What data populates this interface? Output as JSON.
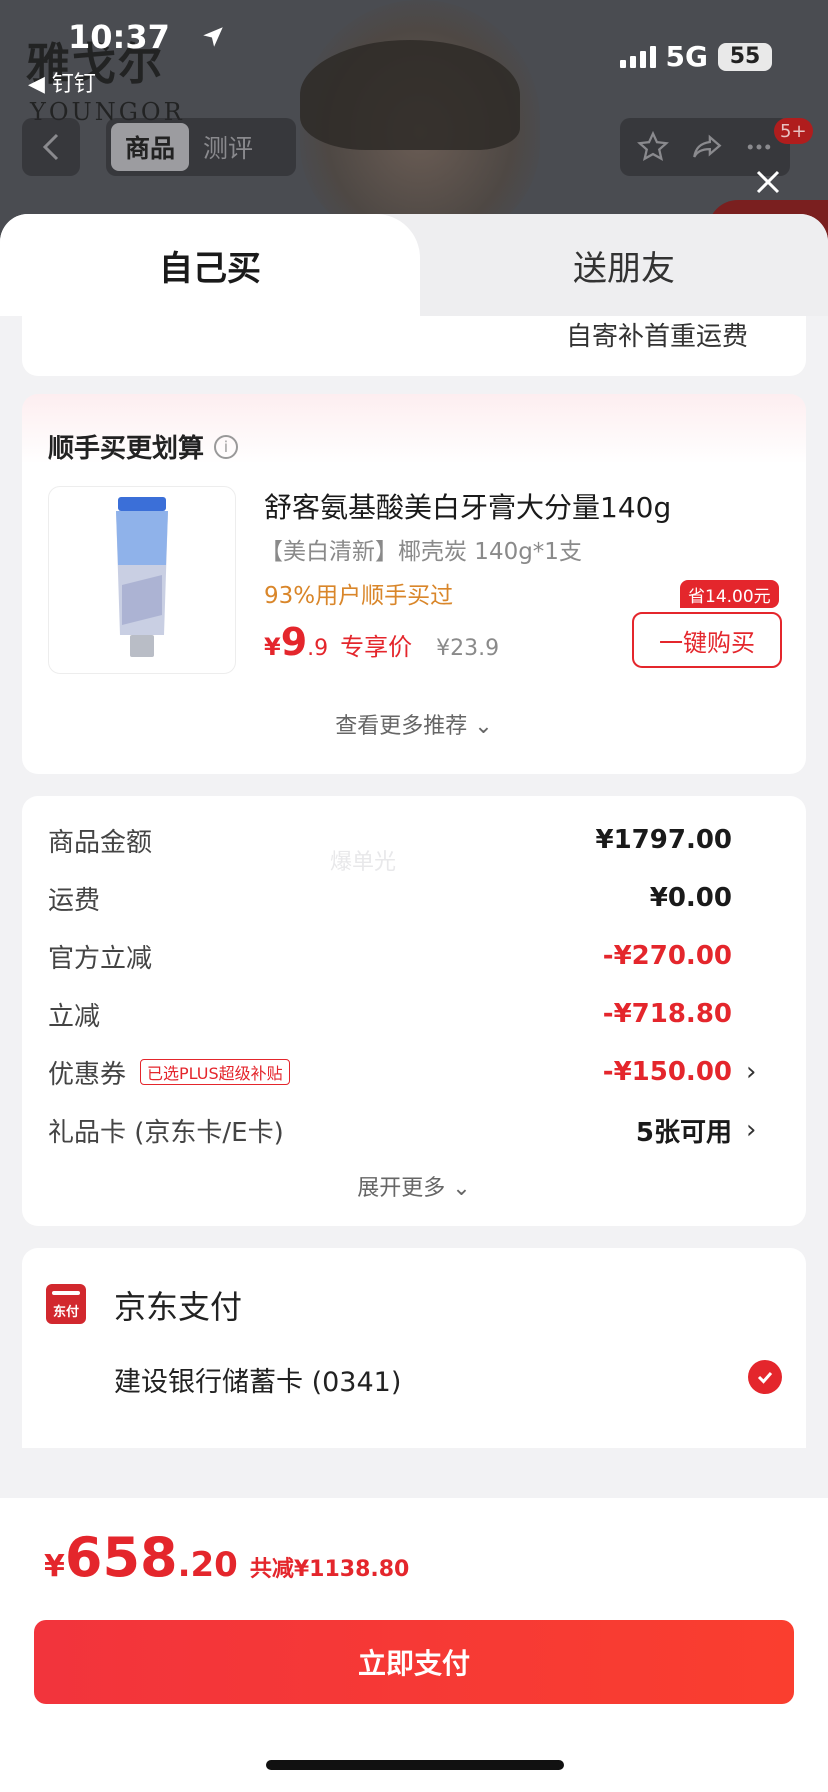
{
  "status_bar": {
    "time": "10:37",
    "back_app": "◀ 钉钉",
    "network": "5G",
    "battery": "55"
  },
  "background_page": {
    "brand_cn": "雅戈尔",
    "brand_en": "YOUNGOR",
    "tabs": [
      "商品",
      "测评"
    ],
    "badge": "5+"
  },
  "sheet": {
    "tabs": {
      "active": "自己买",
      "inactive": "送朋友"
    },
    "shipping_note": "自寄补首重运费"
  },
  "recommend": {
    "title": "顺手买更划算",
    "info_icon": "i",
    "product": {
      "name": "舒客氨基酸美白牙膏大分量140g",
      "spec": "【美白清新】椰壳炭 140g*1支",
      "hint": "93%用户顺手买过",
      "price_symbol": "¥",
      "price_int": "9",
      "price_dec": ".9",
      "price_tag": "专享价",
      "original_price": "¥23.9",
      "save_badge": "省14.00元",
      "buy_button": "一键购买"
    },
    "see_more": "查看更多推荐 ⌄"
  },
  "fees": {
    "watermark": "爆单光",
    "rows": [
      {
        "label": "商品金额",
        "value": "¥1797.00"
      },
      {
        "label": "运费",
        "value": "¥0.00"
      },
      {
        "label": "官方立减",
        "value": "-¥270.00"
      },
      {
        "label": "立减",
        "value": "-¥718.80"
      },
      {
        "label": "优惠券",
        "tag": "已选PLUS超级补贴",
        "value": "-¥150.00",
        "chevron": "›"
      },
      {
        "label": "礼品卡 (京东卡/E卡)",
        "value": "5张可用",
        "chevron": "›"
      }
    ],
    "expand_more": "展开更多 ⌄"
  },
  "payment": {
    "icon_text": "东付",
    "method": "京东支付",
    "card": "建设银行储蓄卡 (0341)"
  },
  "bottom_bar": {
    "currency": "¥",
    "total_int": "658",
    "total_dec": ".20",
    "saved": "共减¥1138.80",
    "pay_button": "立即支付"
  },
  "colors": {
    "accent_red": "#e4262c",
    "hint_orange": "#d9862a",
    "sheet_bg": "#f2f2f4"
  }
}
